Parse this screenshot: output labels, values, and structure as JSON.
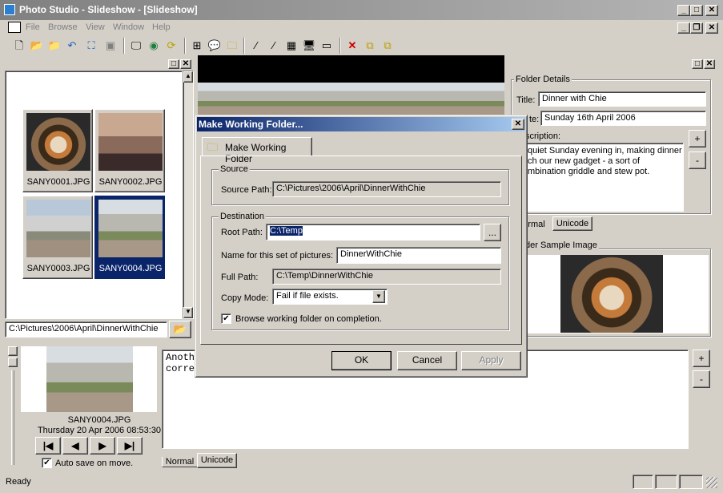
{
  "window": {
    "title": "Photo Studio - Slideshow - [Slideshow]"
  },
  "menu": {
    "items": [
      "File",
      "Browse",
      "View",
      "Window",
      "Help"
    ]
  },
  "toolbar": {
    "icons": [
      "new-icon",
      "open-icon",
      "open-folder-icon",
      "undo-icon",
      "select-icon",
      "save-icon",
      "view-icon",
      "globe-icon",
      "refresh-icon",
      "grid-icon",
      "comment-icon",
      "folder-comment-icon",
      "wand-icon",
      "wand-alt-icon",
      "film-icon",
      "monitor-icon",
      "slideshow-icon",
      "delete-icon",
      "copy-icon",
      "paste-icon"
    ]
  },
  "thumbnails": [
    {
      "label": "SANY0001.JPG",
      "selected": false
    },
    {
      "label": "SANY0002.JPG",
      "selected": false
    },
    {
      "label": "SANY0003.JPG",
      "selected": false
    },
    {
      "label": "SANY0004.JPG",
      "selected": true
    }
  ],
  "browser": {
    "path": "C:\\Pictures\\2006\\April\\DinnerWithChie"
  },
  "preview": {
    "filename": "SANY0004.JPG",
    "datetime": "Thursday 20 Apr 2006 08:53:30",
    "autosave_label": "Auto save on move.",
    "autosave_checked": true
  },
  "caption": {
    "text": "Anoth                                          ite balance set\ncorre",
    "tabs": [
      "Normal",
      "Unicode"
    ],
    "plus": "+",
    "minus": "-"
  },
  "folder_details": {
    "group_title": "Folder Details",
    "title_label": "Title:",
    "title_value": "Dinner with Chie",
    "date_label": "te:",
    "date_value": "Sunday 16th April 2006",
    "desc_label": "scription:",
    "desc_value": "quiet Sunday evening in, making dinner\nch our new gadget - a sort of\nmbination griddle and stew pot.",
    "tabs": [
      "rmal",
      "Unicode"
    ],
    "plus": "+",
    "minus": "-"
  },
  "sample": {
    "title": "der Sample Image"
  },
  "status": {
    "text": "Ready"
  },
  "dialog": {
    "title": "Make Working Folder...",
    "tab_label": "Make Working Folder",
    "source_group": "Source",
    "source_path_label": "Source Path:",
    "source_path_value": "C:\\Pictures\\2006\\April\\DinnerWithChie",
    "dest_group": "Destination",
    "root_path_label": "Root Path:",
    "root_path_value": "C:\\Temp",
    "browse_label": "...",
    "name_label": "Name for this set of pictures:",
    "name_value": "DinnerWithChie",
    "full_path_label": "Full Path:",
    "full_path_value": "C:\\Temp\\DinnerWithChie",
    "copy_mode_label": "Copy Mode:",
    "copy_mode_value": "Fail if file exists.",
    "browse_on_completion_label": "Browse working folder on completion.",
    "browse_on_completion_checked": true,
    "ok": "OK",
    "cancel": "Cancel",
    "apply": "Apply"
  }
}
